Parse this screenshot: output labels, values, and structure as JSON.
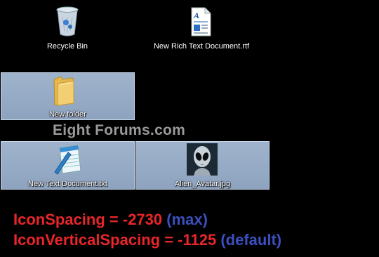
{
  "desktop": {
    "icons": [
      {
        "label": "Recycle Bin"
      },
      {
        "label": "New Rich Text Document.rtf"
      },
      {
        "label": "New folder"
      },
      {
        "label": "New Text Document.txt"
      },
      {
        "label": "Alien_Avatar.jpg"
      }
    ]
  },
  "watermark": "Eight Forums.com",
  "caption": {
    "line1": {
      "setting": "IconSpacing = -2730",
      "note": "(max)"
    },
    "line2": {
      "setting": "IconVerticalSpacing = -1125",
      "note": "(default)"
    }
  },
  "colors": {
    "background": "#000000",
    "setting_text": "#e8262a",
    "note_text": "#3b4fbf",
    "selection": "#8ea3bf",
    "watermark": "#9a9a9a"
  }
}
